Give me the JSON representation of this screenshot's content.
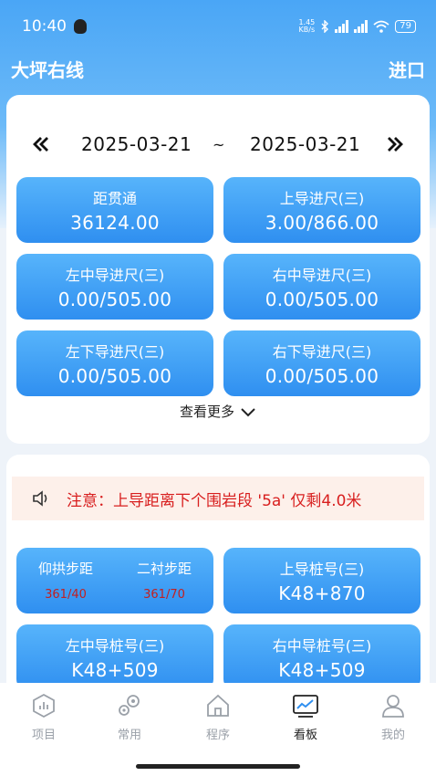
{
  "status": {
    "time": "10:40",
    "speed_value": "1.45",
    "speed_unit": "KB/s",
    "battery": "79"
  },
  "header": {
    "title": "大坪右线",
    "import_label": "进口"
  },
  "date_range": {
    "start": "2025-03-21",
    "separator": "~",
    "end": "2025-03-21"
  },
  "stats": [
    {
      "label": "距贯通",
      "value": "36124.00"
    },
    {
      "label": "上导进尺(三)",
      "value": "3.00/866.00"
    },
    {
      "label": "左中导进尺(三)",
      "value": "0.00/505.00"
    },
    {
      "label": "右中导进尺(三)",
      "value": "0.00/505.00"
    },
    {
      "label": "左下导进尺(三)",
      "value": "0.00/505.00"
    },
    {
      "label": "右下导进尺(三)",
      "value": "0.00/505.00"
    }
  ],
  "more_label": "查看更多",
  "notice": {
    "text": "注意：上导距离下个围岩段 '5a' 仅剩4.0米"
  },
  "steps": {
    "invert_label": "仰拱步距",
    "invert_value": "361/40",
    "lining_label": "二衬步距",
    "lining_value": "361/70"
  },
  "stakes": [
    {
      "label": "上导桩号(三)",
      "value": "K48+870"
    },
    {
      "label": "左中导桩号(三)",
      "value": "K48+509"
    },
    {
      "label": "右中导桩号(三)",
      "value": "K48+509"
    }
  ],
  "tabs": [
    {
      "label": "项目",
      "icon": "project-chart-icon"
    },
    {
      "label": "常用",
      "icon": "gears-icon"
    },
    {
      "label": "程序",
      "icon": "home-icon"
    },
    {
      "label": "看板",
      "icon": "dashboard-icon",
      "active": true
    },
    {
      "label": "我的",
      "icon": "user-icon"
    }
  ],
  "colors": {
    "accent": "#2f8ff0",
    "notice_text": "#d81e1e",
    "notice_bg": "#fdf0ea"
  }
}
